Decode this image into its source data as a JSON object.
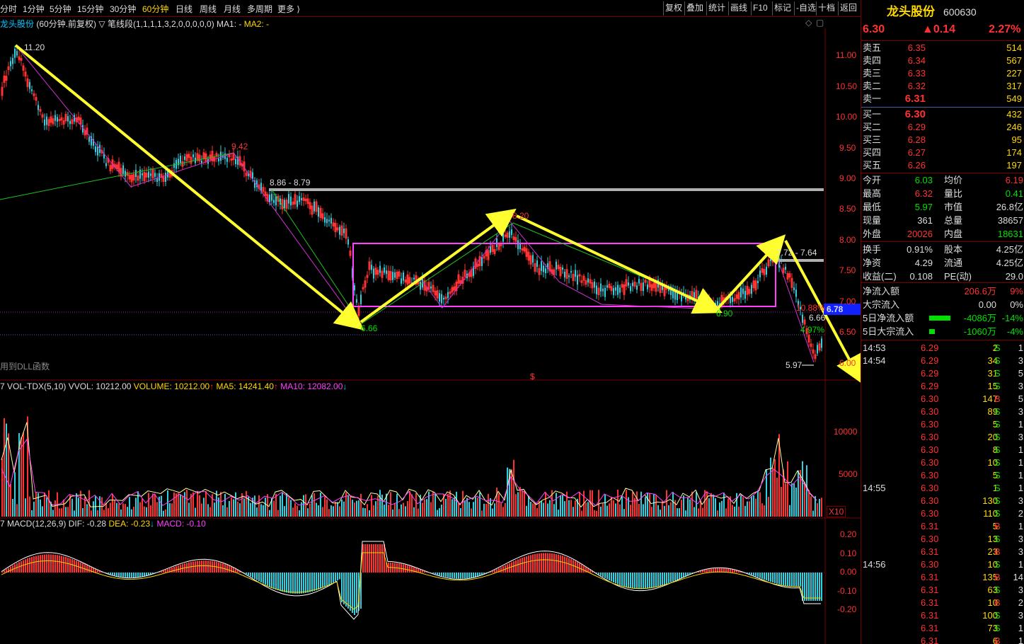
{
  "periods": [
    "分时",
    "1分钟",
    "5分钟",
    "15分钟",
    "30分钟",
    "60分钟",
    "日线",
    "周线",
    "月线",
    "多周期",
    "更多 ⟩"
  ],
  "active_period": "60分钟",
  "toolbar": [
    "复权",
    "叠加",
    "统计",
    "画线",
    "F10",
    "标记",
    "-自选",
    "十档",
    "返回"
  ],
  "chart_header": {
    "name": "龙头股份",
    "mode": "(60分钟.前复权)",
    "indicator": "▽ 笔线段(1,1,1,1,3,2,0,0,0,0,0)",
    "ma1": "MA1: -",
    "ma2": "MA2: -"
  },
  "price_axis": [
    "11.00",
    "10.50",
    "10.00",
    "9.50",
    "9.00",
    "8.50",
    "8.00",
    "7.50",
    "7.00",
    "6.50",
    "6.00"
  ],
  "price_annotations": {
    "high": "11.20",
    "p942": "9.42",
    "range1": "8.86 - 8.79",
    "p820": "8.20",
    "range2": "7.72 - 7.64",
    "low1": "6.66",
    "low2": "6.90",
    "low3": "5.97",
    "r1": "10.88%",
    "r2": "6.66",
    "r3": "4.97%",
    "cur_tag": "6.78",
    "dll": "用到DLL函数"
  },
  "volume_header": {
    "name": "VOL-TDX(5,10)",
    "vvol": "VVOL: 10212.00",
    "volume": "VOLUME: 10212.00",
    "ma5": "MA5: 14241.40",
    "ma10": "MA10: 12082.00"
  },
  "volume_axis": [
    "10000",
    "5000"
  ],
  "volume_unit": "X10",
  "macd_header": {
    "name": "MACD(12,26,9)",
    "dif": "DIF: -0.28",
    "dea": "DEA: -0.23",
    "macd": "MACD: -0.10"
  },
  "macd_axis": [
    "0.20",
    "0.10",
    "0.00",
    "-0.10",
    "-0.20"
  ],
  "stock": {
    "name": "龙头股份",
    "code": "600630",
    "price": "6.30",
    "change": "▲0.14",
    "pct": "2.27%"
  },
  "sells": [
    {
      "label": "卖五",
      "price": "6.35",
      "vol": "514"
    },
    {
      "label": "卖四",
      "price": "6.34",
      "vol": "567"
    },
    {
      "label": "卖三",
      "price": "6.33",
      "vol": "227"
    },
    {
      "label": "卖二",
      "price": "6.32",
      "vol": "317"
    },
    {
      "label": "卖一",
      "price": "6.31",
      "vol": "549"
    }
  ],
  "buys": [
    {
      "label": "买一",
      "price": "6.30",
      "vol": "432"
    },
    {
      "label": "买二",
      "price": "6.29",
      "vol": "246"
    },
    {
      "label": "买三",
      "price": "6.28",
      "vol": "95"
    },
    {
      "label": "买四",
      "price": "6.27",
      "vol": "174"
    },
    {
      "label": "买五",
      "price": "6.26",
      "vol": "197"
    }
  ],
  "stats": [
    {
      "l1": "今开",
      "v1": "6.03",
      "c1": "green",
      "l2": "均价",
      "v2": "6.19",
      "c2": "red"
    },
    {
      "l1": "最高",
      "v1": "6.32",
      "c1": "red",
      "l2": "量比",
      "v2": "0.41",
      "c2": "green"
    },
    {
      "l1": "最低",
      "v1": "5.97",
      "c1": "green",
      "l2": "市值",
      "v2": "26.8亿",
      "c2": "white"
    },
    {
      "l1": "现量",
      "v1": "361",
      "c1": "white",
      "l2": "总量",
      "v2": "38657",
      "c2": "white"
    },
    {
      "l1": "外盘",
      "v1": "20026",
      "c1": "red",
      "l2": "内盘",
      "v2": "18631",
      "c2": "green"
    }
  ],
  "stats2": [
    {
      "l1": "换手",
      "v1": "0.91%",
      "l2": "股本",
      "v2": "4.25亿"
    },
    {
      "l1": "净资",
      "v1": "4.29",
      "l2": "流通",
      "v2": "4.25亿"
    },
    {
      "l1": "收益(二)",
      "v1": "0.108",
      "l2": "PE(动)",
      "v2": "29.0"
    }
  ],
  "flows": [
    {
      "label": "净流入额",
      "value": "206.6万",
      "pct": "9%",
      "color": "red"
    },
    {
      "label": "大宗流入",
      "value": "0.00",
      "pct": "0%",
      "color": "white"
    },
    {
      "label": "5日净流入额",
      "value": "-4086万",
      "pct": "-14%",
      "color": "green"
    },
    {
      "label": "5日大宗流入",
      "value": "-1060万",
      "pct": "-4%",
      "color": "green"
    }
  ],
  "ticks": [
    {
      "time": "14:53",
      "price": "6.29",
      "vol": "2",
      "side": "S",
      "n": "1"
    },
    {
      "time": "14:54",
      "price": "6.29",
      "vol": "34",
      "side": "S",
      "n": "3"
    },
    {
      "time": "",
      "price": "6.29",
      "vol": "31",
      "side": "S",
      "n": "5"
    },
    {
      "time": "",
      "price": "6.29",
      "vol": "15",
      "side": "S",
      "n": "3"
    },
    {
      "time": "",
      "price": "6.30",
      "vol": "147",
      "side": "B",
      "n": "5"
    },
    {
      "time": "",
      "price": "6.30",
      "vol": "89",
      "side": "S",
      "n": "3"
    },
    {
      "time": "",
      "price": "6.30",
      "vol": "5",
      "side": "S",
      "n": "1"
    },
    {
      "time": "",
      "price": "6.30",
      "vol": "20",
      "side": "S",
      "n": "3"
    },
    {
      "time": "",
      "price": "6.30",
      "vol": "8",
      "side": "S",
      "n": "1"
    },
    {
      "time": "",
      "price": "6.30",
      "vol": "10",
      "side": "S",
      "n": "1"
    },
    {
      "time": "",
      "price": "6.30",
      "vol": "5",
      "side": "S",
      "n": "1"
    },
    {
      "time": "14:55",
      "price": "6.30",
      "vol": "1",
      "side": "S",
      "n": "1"
    },
    {
      "time": "",
      "price": "6.30",
      "vol": "130",
      "side": "S",
      "n": "3"
    },
    {
      "time": "",
      "price": "6.30",
      "vol": "110",
      "side": "S",
      "n": "2"
    },
    {
      "time": "",
      "price": "6.31",
      "vol": "5",
      "side": "B",
      "n": "1"
    },
    {
      "time": "",
      "price": "6.30",
      "vol": "13",
      "side": "S",
      "n": "3"
    },
    {
      "time": "",
      "price": "6.31",
      "vol": "23",
      "side": "B",
      "n": "3"
    },
    {
      "time": "14:56",
      "price": "6.30",
      "vol": "10",
      "side": "S",
      "n": "1"
    },
    {
      "time": "",
      "price": "6.31",
      "vol": "135",
      "side": "B",
      "n": "14"
    },
    {
      "time": "",
      "price": "6.31",
      "vol": "63",
      "side": "S",
      "n": "3"
    },
    {
      "time": "",
      "price": "6.31",
      "vol": "10",
      "side": "B",
      "n": "2"
    },
    {
      "time": "",
      "price": "6.31",
      "vol": "100",
      "side": "S",
      "n": "3"
    },
    {
      "time": "",
      "price": "6.31",
      "vol": "73",
      "side": "S",
      "n": "1"
    },
    {
      "time": "",
      "price": "6.31",
      "vol": "6",
      "side": "B",
      "n": "1"
    }
  ]
}
